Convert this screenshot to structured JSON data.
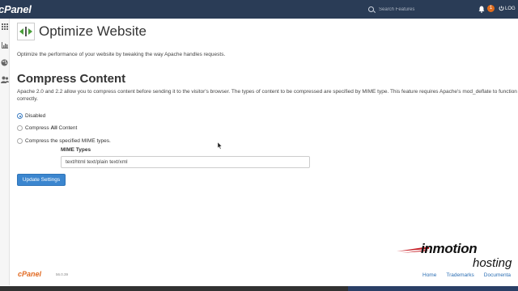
{
  "topbar": {
    "logo": "cPanel",
    "search_placeholder": "Search Features",
    "notification_count": "1",
    "logout_label": "LOG"
  },
  "page": {
    "title": "Optimize Website",
    "description": "Optimize the performance of your website by tweaking the way Apache handles requests."
  },
  "compress": {
    "title": "Compress Content",
    "description": "Apache 2.0 and 2.2 allow you to compress content before sending it to the visitor's browser. The types of content to be compressed are specified by MIME type. This feature requires Apache's mod_deflate to function correctly.",
    "options": [
      {
        "label": "Disabled",
        "checked": true
      },
      {
        "label_prefix": "Compress ",
        "label_bold": "All",
        "label_suffix": " Content",
        "checked": false
      },
      {
        "label": "Compress the specified MIME types.",
        "checked": false
      }
    ],
    "mime_label": "MIME Types",
    "mime_value": "text/html text/plain text/xml",
    "update_button": "Update Settings"
  },
  "footer": {
    "logo": "cPanel",
    "version": "56.0.39",
    "links": [
      "Home",
      "Trademarks",
      "Documenta"
    ]
  },
  "brand": {
    "top": "inmotion",
    "bottom": "hosting"
  },
  "colors": {
    "topbar": "#2a3c56",
    "accent_blue": "#3b86cf",
    "badge_orange": "#e06c1d",
    "footer_logo": "#e16a22",
    "inmotion_swoosh": "#c8242b"
  },
  "icons": [
    "search-icon",
    "bell-icon",
    "logout-icon",
    "grid-icon",
    "stats-icon",
    "palette-icon",
    "users-icon",
    "optimize-icon"
  ]
}
